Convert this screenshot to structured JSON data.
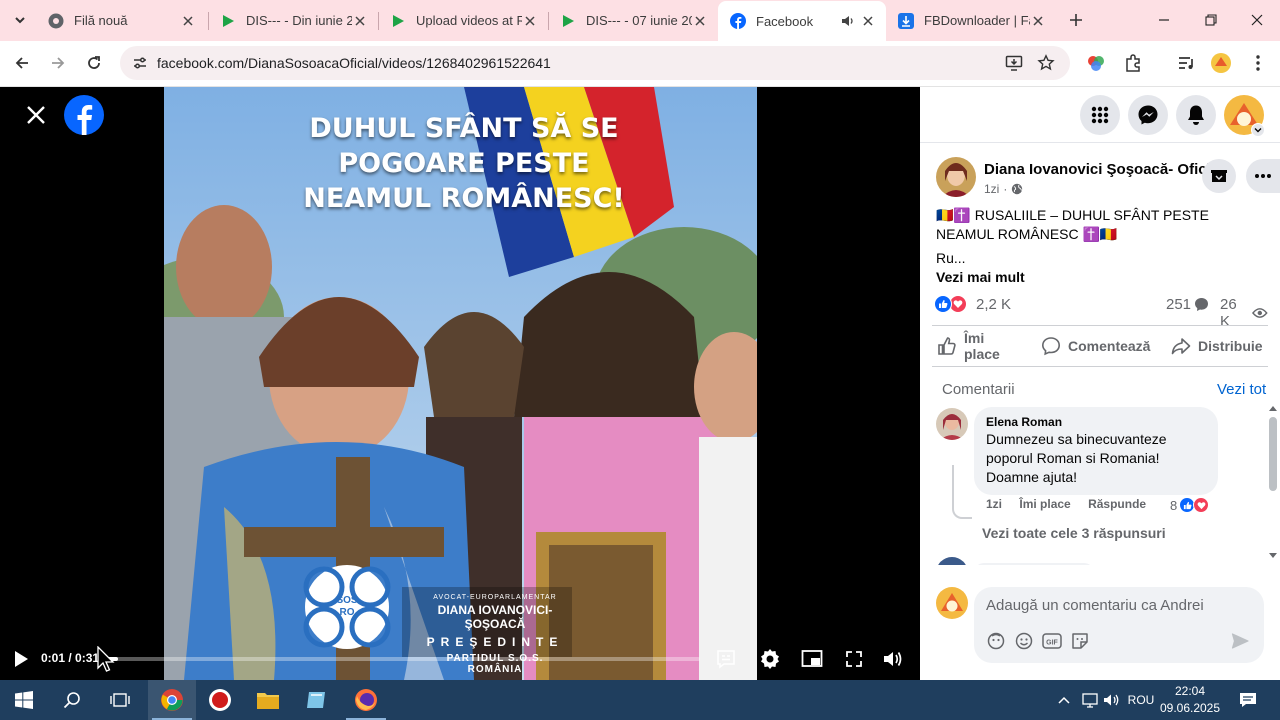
{
  "browser": {
    "tabs": [
      {
        "title": "Filă nouă",
        "icon": "chrome-icon",
        "active": false
      },
      {
        "title": "DIS--- - Din iunie 2",
        "icon": "video-play-icon",
        "active": false
      },
      {
        "title": "Upload videos at R",
        "icon": "video-play-icon",
        "active": false
      },
      {
        "title": "DIS--- - 07 iunie 20",
        "icon": "video-play-icon",
        "active": false
      },
      {
        "title": "Facebook",
        "icon": "facebook-icon",
        "active": true
      },
      {
        "title": "FBDownloader | Fa",
        "icon": "download-icon",
        "active": false
      }
    ],
    "url": "facebook.com/DianaSosoacaOficial/videos/1268402961522641"
  },
  "video": {
    "headline": "DUHUL SFÂNT SĂ SE POGOARE PESTE NEAMUL ROMÂNESC!",
    "badge_line1": "SOS",
    "badge_line2": "RO",
    "lower_line1": "AVOCAT-EUROPARLAMENTAR",
    "lower_line2": "DIANA IOVANOVICI-ŞOŞOACĂ",
    "lower_line3": "PREŞEDINTE",
    "lower_line4": "PARTIDUL S.O.S. ROMÂNIA",
    "time": "0:01 / 0:31",
    "progress": 0.03
  },
  "post": {
    "author": "Diana Iovanovici Şoşoacă- Oficial",
    "time": "1zi",
    "text": "🇷🇴✝️ RUSALIILE – DUHUL SFÂNT PESTE NEAMUL ROMÂNESC ✝️🇷🇴",
    "ellipsis": "Ru...",
    "see_more": "Vezi mai mult",
    "reaction_count": "2,2 K",
    "comment_count": "251",
    "view_count": "26 K",
    "actions": {
      "like": "Îmi place",
      "comment": "Comentează",
      "share": "Distribuie"
    }
  },
  "comments": {
    "heading": "Comentarii",
    "see_all": "Vezi tot",
    "items": [
      {
        "name": "Elena Roman",
        "text": "Dumnezeu sa binecuvanteze poporul Roman si Romania! Doamne ajuta!",
        "time": "1zi",
        "like": "Îmi place",
        "reply": "Răspunde",
        "reactions": "8",
        "replies": "Vezi toate cele 3 răspunsuri"
      }
    ],
    "composer_placeholder": "Adaugă un comentariu ca Andrei"
  },
  "taskbar": {
    "language": "ROU",
    "time": "22:04",
    "date": "09.06.2025"
  },
  "colors": {
    "facebook_blue": "#0866ff",
    "tabstrip": "#fde0e4",
    "taskbar": "#1f3e5e",
    "link": "#0064d1"
  }
}
